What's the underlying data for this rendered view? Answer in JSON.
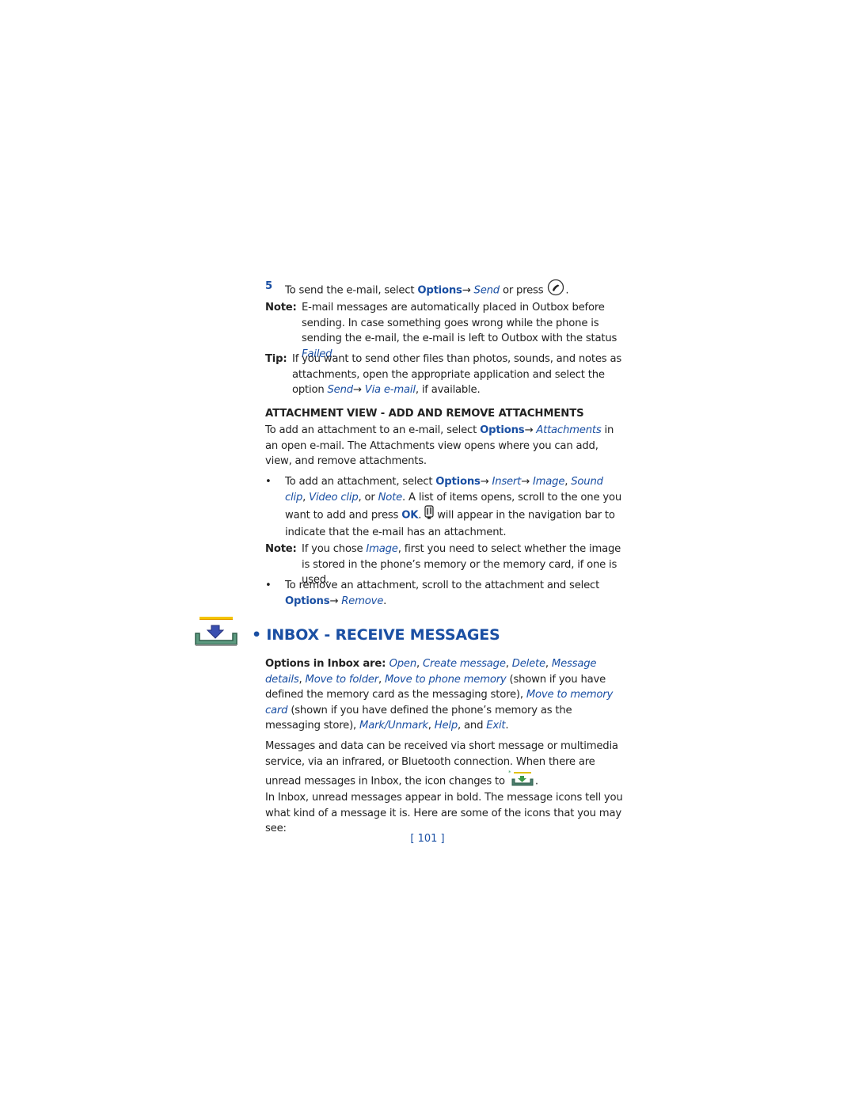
{
  "step5": {
    "number": "5",
    "pre": "To send the e-mail, select ",
    "options": "Options",
    "arrow": "→ ",
    "send": "Send",
    "mid": " or press ",
    "post": ".",
    "icon": "call-key-icon"
  },
  "note1": {
    "label": "Note:",
    "text_pre": "E-mail messages are automatically placed in Outbox before sending. In case something goes wrong while the phone is sending the e-mail, the e-mail is left to Outbox with the status ",
    "failed": "Failed",
    "text_post": "."
  },
  "tip": {
    "label": "Tip:",
    "text_pre": "If you want to send other files than photos, sounds, and notes as attachments, open the appropriate application and select the option ",
    "send": "Send",
    "arrow": "→ ",
    "via": "Via e-mail",
    "text_post": ", if available."
  },
  "attachment_section": {
    "heading": "ATTACHMENT VIEW - ADD AND REMOVE ATTACHMENTS",
    "intro_pre": "To add an attachment to an e-mail, select ",
    "options": "Options",
    "arrow": "→ ",
    "attachments": "Attachments",
    "intro_post": " in an open e-mail. The Attachments view opens where you can add, view, and remove attachments.",
    "bullet1": {
      "pre": "To add an attachment, select ",
      "options": "Options",
      "arrow1": "→ ",
      "insert": "Insert",
      "arrow2": "→ ",
      "image": "Image",
      "sep1": ", ",
      "sound": "Sound clip",
      "sep2": ", ",
      "video": "Video clip",
      "sep3": ", or ",
      "note": "Note",
      "mid": ". A list of items opens, scroll to the one you want to add and press ",
      "ok": "OK",
      "dot": ". ",
      "icon": "paperclip-icon",
      "post": " will appear in the navigation bar to indicate that the e-mail has an attachment."
    },
    "note2": {
      "label": "Note:",
      "pre": "If you chose ",
      "image": "Image",
      "post": ", first you need to select whether the image is stored in the phone’s memory or the memory card, if one is used."
    },
    "bullet2": {
      "pre": "To remove an attachment, scroll to the attachment and select ",
      "options": "Options",
      "arrow": "→ ",
      "remove": "Remove",
      "post": "."
    }
  },
  "inbox_section": {
    "icon": "inbox-icon",
    "heading": "• INBOX - RECEIVE MESSAGES",
    "options_para": {
      "label": "Options in Inbox are: ",
      "open": "Open",
      "s1": ", ",
      "create": "Create message",
      "s2": ", ",
      "delete": "Delete",
      "s3": ", ",
      "details": "Message details",
      "s4": ", ",
      "move_folder": "Move to folder",
      "s5": ", ",
      "move_phone": "Move to phone memory",
      "t1": " (shown if you have defined the memory card as the messaging store), ",
      "move_card": "Move to memory card",
      "t2": " (shown if you have defined the phone’s memory as the messaging store), ",
      "mark": "Mark/Unmark",
      "s6": ", ",
      "help": "Help",
      "s7": ", and ",
      "exit": "Exit",
      "end": "."
    },
    "para2_pre": "Messages and data can be received via short message or multimedia service, via an infrared, or Bluetooth connection. When there are unread messages in Inbox, the icon changes to ",
    "para2_icon": "unread-inbox-icon",
    "para2_post": ".",
    "para3": "In Inbox, unread messages appear in bold.  The message icons tell you what kind of a message it is. Here are some of the icons that you may see:"
  },
  "page_number": "[ 101 ]",
  "colors": {
    "link_blue": "#1a4fa3",
    "text": "#222222"
  }
}
